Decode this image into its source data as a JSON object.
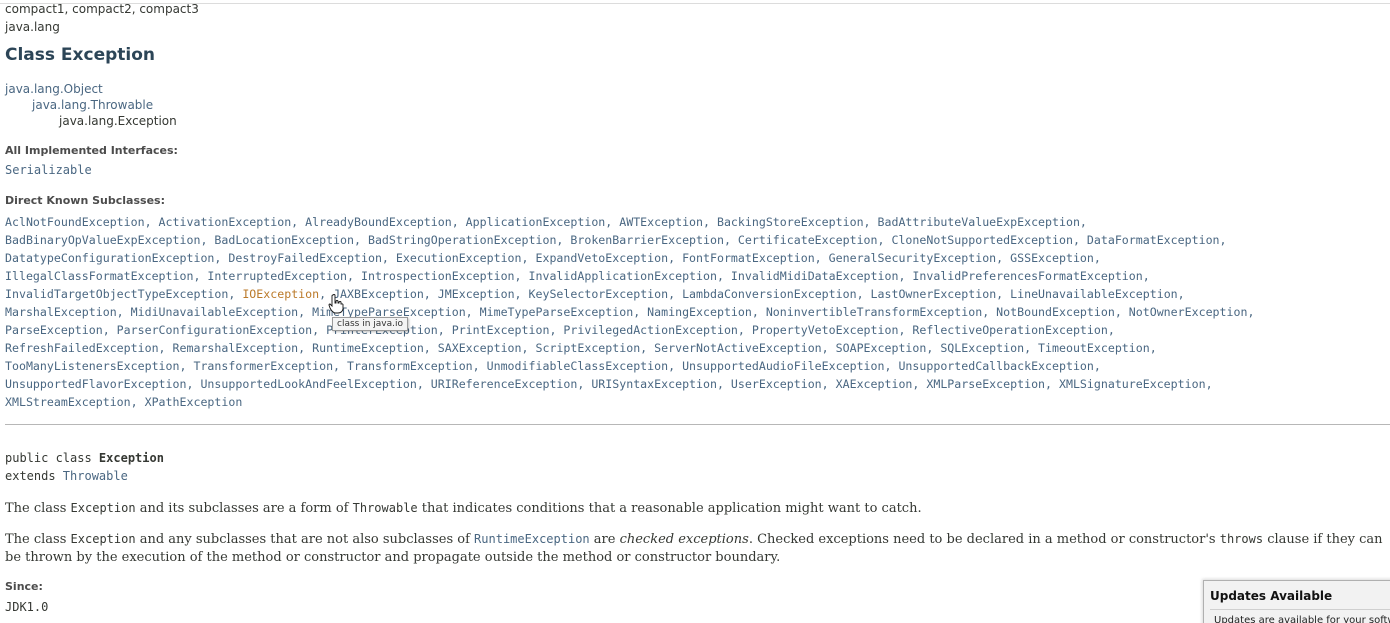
{
  "header": {
    "profiles": "compact1, compact2, compact3",
    "package": "java.lang",
    "title": "Class Exception"
  },
  "inheritance": [
    "java.lang.Object",
    "java.lang.Throwable",
    "java.lang.Exception"
  ],
  "interfaces": {
    "heading": "All Implemented Interfaces:",
    "items": [
      "Serializable"
    ]
  },
  "subclasses": {
    "heading": "Direct Known Subclasses:",
    "lines": [
      "AclNotFoundException, ActivationException, AlreadyBoundException, ApplicationException, AWTException, BackingStoreException, BadAttributeValueExpException,",
      "BadBinaryOpValueExpException, BadLocationException, BadStringOperationException, BrokenBarrierException, CertificateException, CloneNotSupportedException, DataFormatException,",
      "DatatypeConfigurationException, DestroyFailedException, ExecutionException, ExpandVetoException, FontFormatException, GeneralSecurityException, GSSException,",
      "IllegalClassFormatException, InterruptedException, IntrospectionException, InvalidApplicationException, InvalidMidiDataException, InvalidPreferencesFormatException,",
      "MarshalException, MidiUnavailableException, MimeTypeParseException, MimeTypeParseException, NamingException, NoninvertibleTransformException, NotBoundException, NotOwnerException,",
      "ParseException, ParserConfigurationException, PrinterException, PrintException, PrivilegedActionException, PropertyVetoException, ReflectiveOperationException,",
      "RefreshFailedException, RemarshalException, RuntimeException, SAXException, ScriptException, ServerNotActiveException, SOAPException, SQLException, TimeoutException,",
      "TooManyListenersException, TransformerException, TransformException, UnmodifiableClassException, UnsupportedAudioFileException, UnsupportedCallbackException,",
      "UnsupportedFlavorException, UnsupportedLookAndFeelException, URIReferenceException, URISyntaxException, UserException, XAException, XMLParseException, XMLSignatureException,",
      "XMLStreamException, XPathException"
    ],
    "line5_before": "InvalidTargetObjectTypeException, ",
    "line5_highlight": "IOException",
    "line5_after": ", JAXBException, JMException, KeySelectorException, LambdaConversionException, LastOwnerException, LineUnavailableException,",
    "tooltip": "class in java.io"
  },
  "declaration": {
    "line1_prefix": "public class ",
    "line1_name": "Exception",
    "line2_prefix": "extends ",
    "line2_link": "Throwable"
  },
  "description": {
    "p1_a": "The class ",
    "p1_code1": "Exception",
    "p1_b": " and its subclasses are a form of ",
    "p1_code2": "Throwable",
    "p1_c": " that indicates conditions that a reasonable application might want to catch.",
    "p2_a": "The class ",
    "p2_code1": "Exception",
    "p2_b": " and any subclasses that are not also subclasses of ",
    "p2_link": "RuntimeException",
    "p2_c": " are ",
    "p2_em": "checked exceptions",
    "p2_d": ". Checked exceptions need to be declared in a method or constructor's ",
    "p2_code2": "throws",
    "p2_e": " clause if they can be thrown by the execution of the method or constructor and propagate outside the method or constructor boundary."
  },
  "since": {
    "heading": "Since:",
    "value": "JDK1.0"
  },
  "notification": {
    "title": "Updates Available",
    "text": "Updates are available for your softw"
  },
  "colors": {
    "title": "#2c4557",
    "link": "#4a6782",
    "hovered_link": "#bb7a2a",
    "text": "#353833"
  },
  "icons": [
    "hand-pointer-icon"
  ]
}
